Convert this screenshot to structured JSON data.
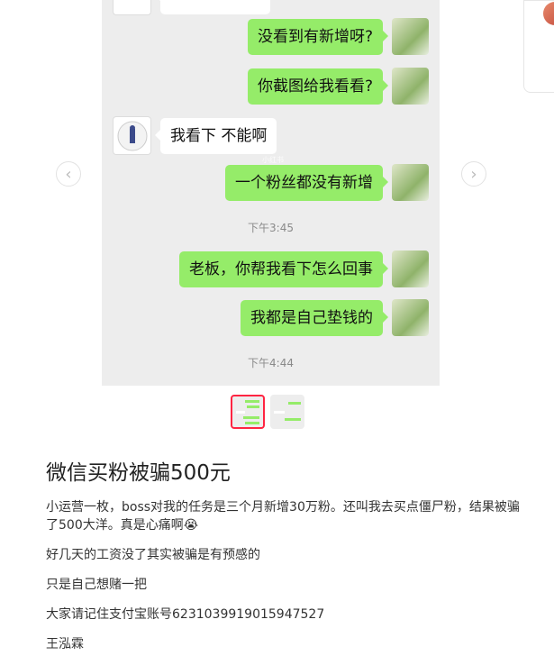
{
  "chat": {
    "messages": [
      {
        "side": "me",
        "text": "没看到有新增呀?"
      },
      {
        "side": "me",
        "text": "你截图给我看看?"
      },
      {
        "side": "them",
        "text": "我看下  不能啊"
      },
      {
        "side": "me",
        "text": "一个粉丝都没有新增"
      },
      {
        "side": "time",
        "text": "下午3:45"
      },
      {
        "side": "me",
        "text": "老板，你帮我看下怎么回事"
      },
      {
        "side": "me",
        "text": "我都是自己垫钱的"
      },
      {
        "side": "time",
        "text": "下午4:44"
      }
    ],
    "watermark": "小红书"
  },
  "nav": {
    "prev": "‹",
    "next": "›"
  },
  "post": {
    "title": "微信买粉被骗500元",
    "paragraphs": [
      "小运营一枚，boss对我的任务是三个月新增30万粉。还叫我去买点僵尸粉，结果被骗了500大洋。真是心痛啊😭",
      "好几天的工资没了其实被骗是有预感的",
      "只是自己想赌一把",
      "大家请记住支付宝账号6231039919015947527",
      "王泓霖"
    ]
  },
  "colors": {
    "bubble_me": "#95ec69",
    "chat_bg": "#ededed",
    "accent": "#ff2442"
  }
}
